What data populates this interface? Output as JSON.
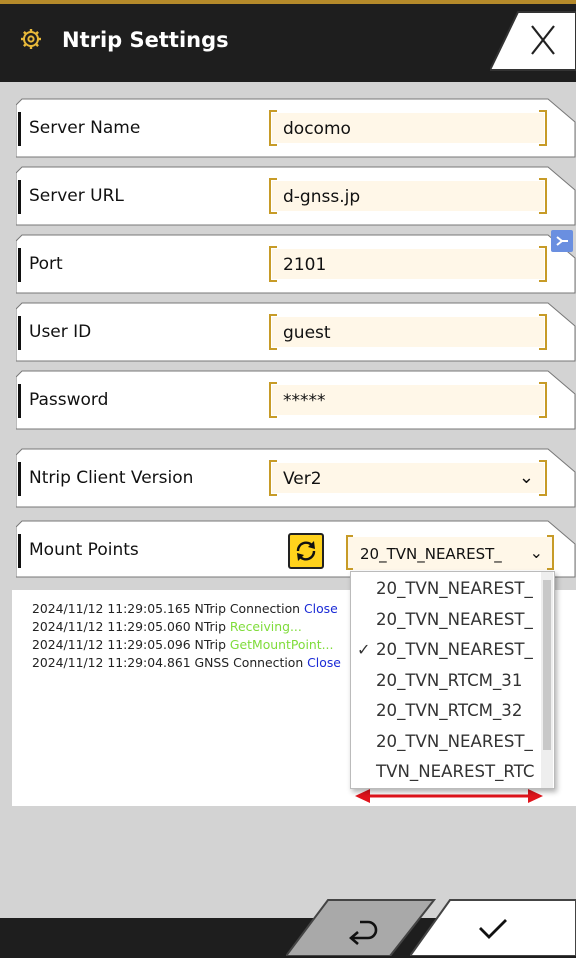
{
  "header": {
    "title": "Ntrip Settings"
  },
  "fields": [
    {
      "label": "Server Name",
      "value": "docomo"
    },
    {
      "label": "Server URL",
      "value": "d-gnss.jp"
    },
    {
      "label": "Port",
      "value": "2101"
    },
    {
      "label": "User ID",
      "value": "guest"
    },
    {
      "label": "Password",
      "value": "*****"
    },
    {
      "label": "Ntrip Client Version",
      "value": "Ver2"
    }
  ],
  "mount": {
    "label": "Mount Points",
    "selected": "20_TVN_NEAREST_",
    "options": [
      {
        "text": "20_TVN_NEAREST_",
        "checked": false
      },
      {
        "text": "20_TVN_NEAREST_",
        "checked": false
      },
      {
        "text": "20_TVN_NEAREST_",
        "checked": true
      },
      {
        "text": "20_TVN_RTCM_31",
        "checked": false
      },
      {
        "text": "20_TVN_RTCM_32",
        "checked": false
      },
      {
        "text": "20_TVN_NEAREST_",
        "checked": false
      },
      {
        "text": "TVN_NEAREST_RTC",
        "checked": false
      }
    ]
  },
  "log": [
    {
      "time": "2024/11/12 11:29:05.165",
      "source": "NTrip Connection",
      "status": "Close",
      "status_type": "blue"
    },
    {
      "time": "2024/11/12 11:29:05.060",
      "source": "NTrip",
      "status": "Receiving...",
      "status_type": "green"
    },
    {
      "time": "2024/11/12 11:29:05.096",
      "source": "NTrip",
      "status": "GetMountPoint...",
      "status_type": "green"
    },
    {
      "time": "2024/11/12 11:29:04.861",
      "source": "GNSS Connection",
      "status": "Close",
      "status_type": "blue"
    }
  ],
  "colors": {
    "accent": "#c79b27",
    "header": "#1e1e1e",
    "status_blue": "#1a2ad6",
    "status_green": "#7fdc3a",
    "refresh": "#ffd21c",
    "arrow": "#e0141c"
  },
  "icons": {
    "header": "gear-icon",
    "close": "close-icon",
    "refresh": "refresh-icon",
    "back": "return-icon",
    "confirm": "check-icon"
  }
}
